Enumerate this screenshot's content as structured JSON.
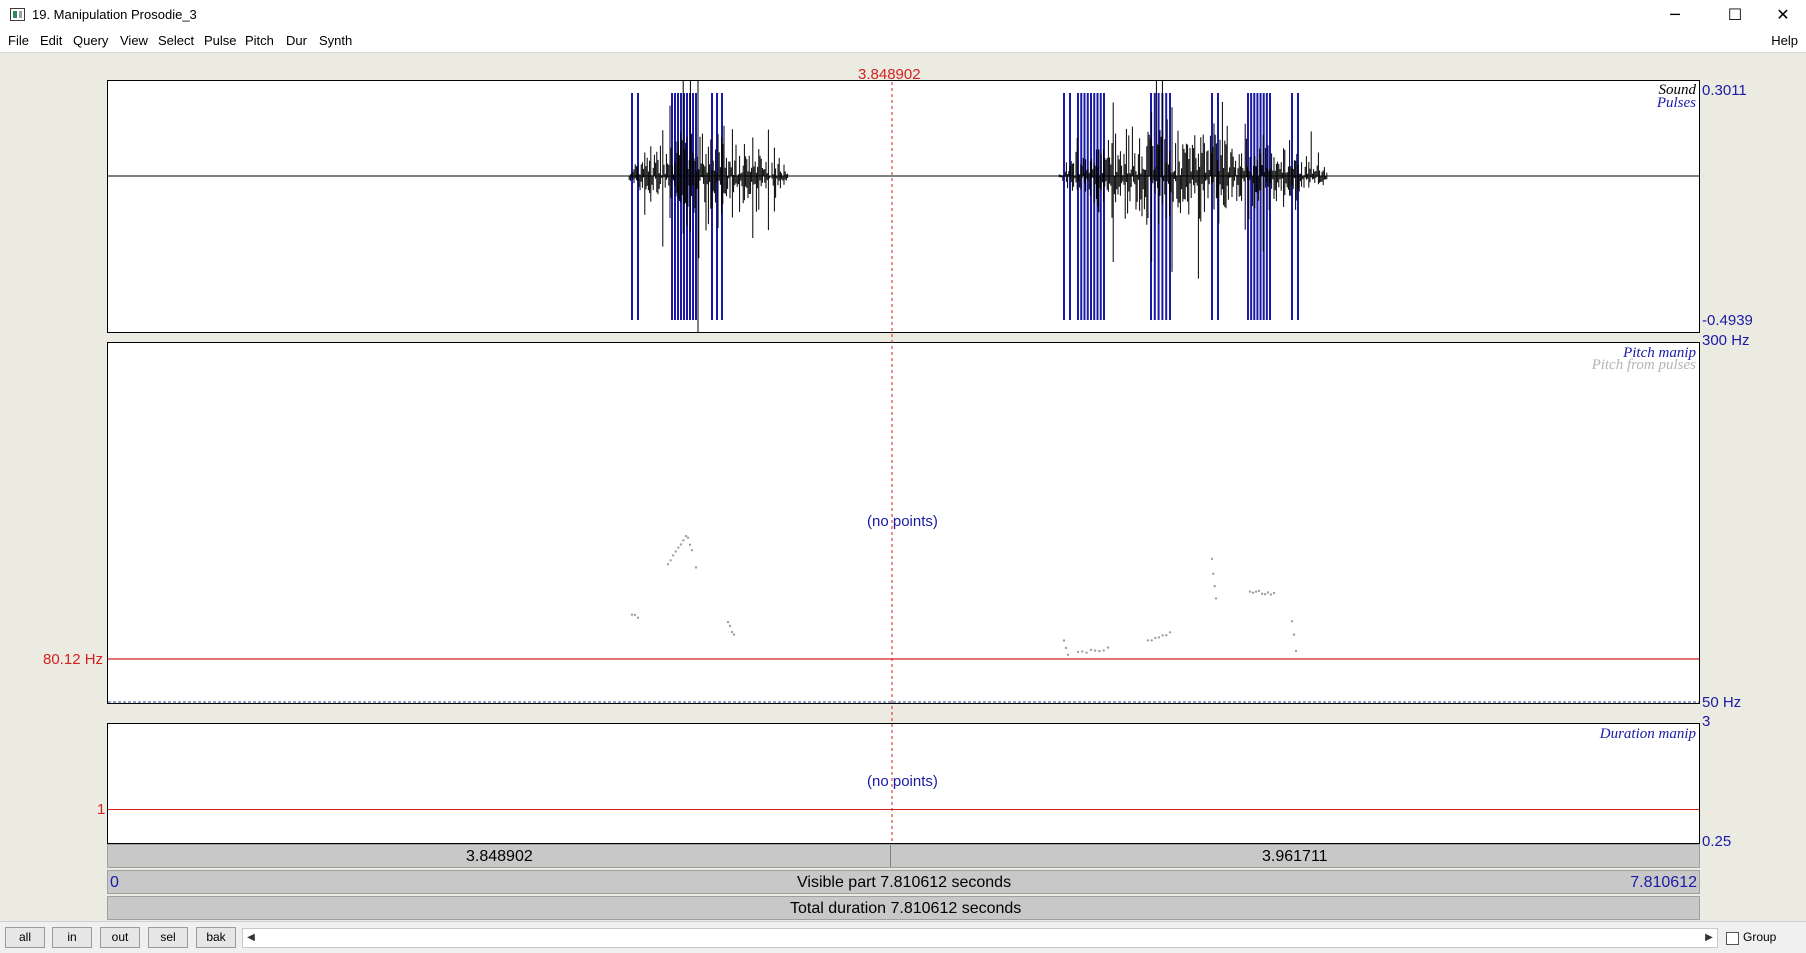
{
  "window": {
    "title": "19. Manipulation Prosodie_3",
    "minimize": "─",
    "maximize": "☐",
    "close": "✕"
  },
  "menu": {
    "items": [
      "File",
      "Edit",
      "Query",
      "View",
      "Select",
      "Pulse",
      "Pitch",
      "Dur",
      "Synth"
    ],
    "help": "Help"
  },
  "cursor": {
    "time_label": "3.848902"
  },
  "sound": {
    "legend_sound": "Sound",
    "legend_pulses": "Pulses",
    "ymax": "0.3011",
    "ymin": "-0.4939",
    "waveform_color": "#000000",
    "pulse_color": "#1a1aa6"
  },
  "pitch": {
    "legend_manip": "Pitch manip",
    "legend_from_pulses": "Pitch from pulses",
    "ymax": "300 Hz",
    "ymin": "50 Hz",
    "cursor_value": "80.12 Hz",
    "no_points": "(no points)"
  },
  "duration": {
    "legend": "Duration manip",
    "ymax": "3",
    "ymin": "0.25",
    "cursor_value": "1",
    "no_points": "(no points)"
  },
  "time_bars": {
    "left_segment": "3.848902",
    "right_segment": "3.961711",
    "visible_start": "0",
    "visible_text": "Visible part 7.810612 seconds",
    "visible_end": "7.810612",
    "total_text": "Total duration 7.810612 seconds"
  },
  "bottom": {
    "buttons": [
      "all",
      "in",
      "out",
      "sel",
      "bak"
    ],
    "left_arrow": "◀",
    "right_arrow": "▶",
    "group_label": "Group"
  },
  "colors": {
    "accent_blue": "#1a1aa6",
    "cursor_red": "#d62020",
    "pitch_gray": "#a0a0a0"
  }
}
